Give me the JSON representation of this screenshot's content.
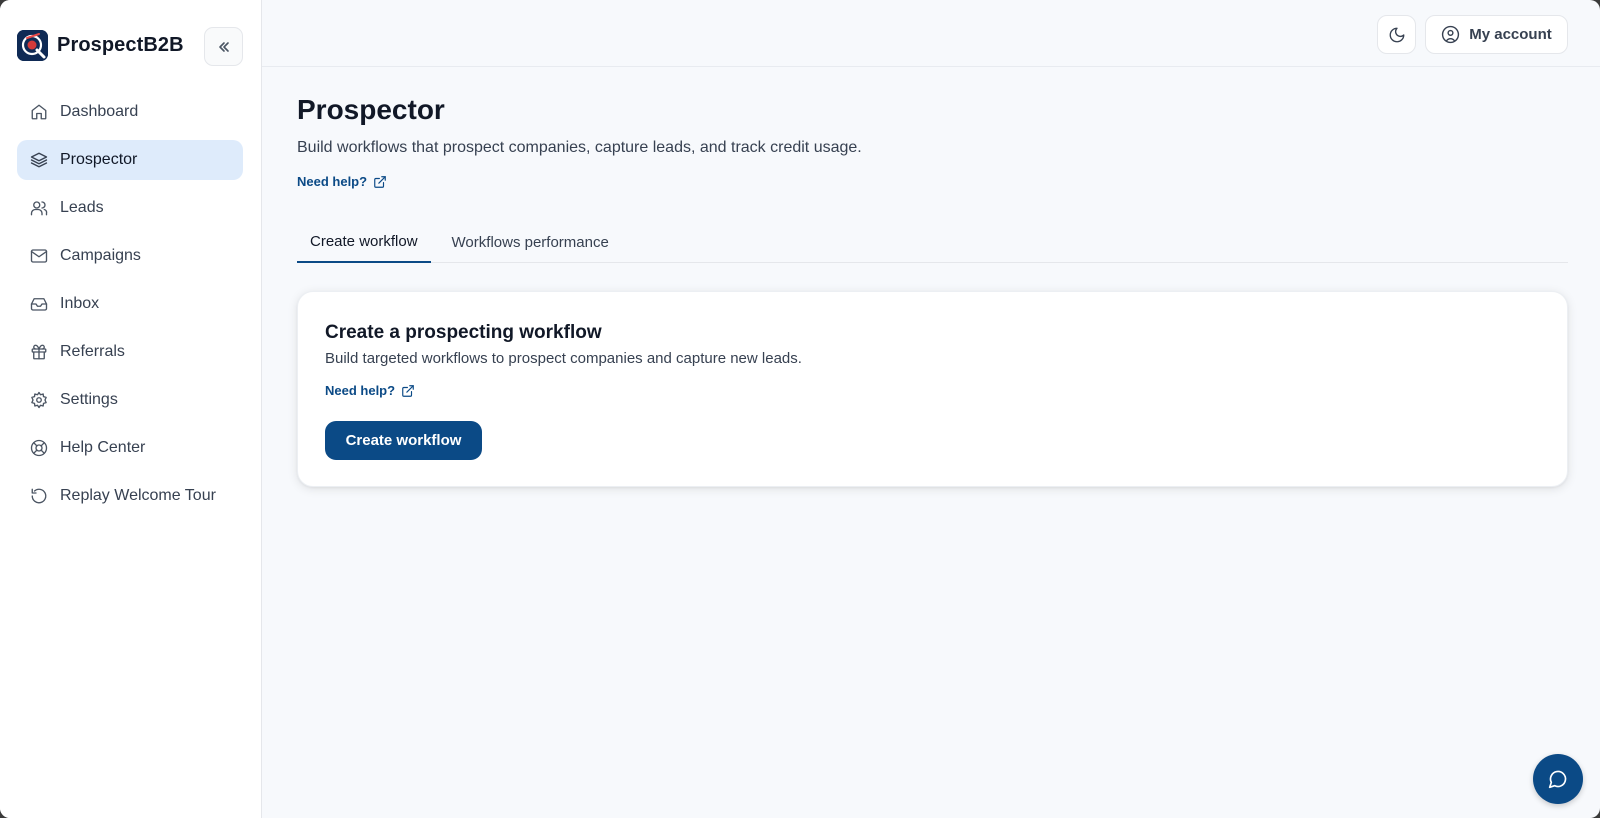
{
  "brand": {
    "name": "ProspectB2B"
  },
  "sidebar": {
    "items": [
      {
        "label": "Dashboard",
        "icon": "home-icon",
        "active": false
      },
      {
        "label": "Prospector",
        "icon": "layers-icon",
        "active": true
      },
      {
        "label": "Leads",
        "icon": "users-icon",
        "active": false
      },
      {
        "label": "Campaigns",
        "icon": "mail-icon",
        "active": false
      },
      {
        "label": "Inbox",
        "icon": "inbox-icon",
        "active": false
      },
      {
        "label": "Referrals",
        "icon": "gift-icon",
        "active": false
      },
      {
        "label": "Settings",
        "icon": "gear-icon",
        "active": false
      },
      {
        "label": "Help Center",
        "icon": "lifebuoy-icon",
        "active": false
      },
      {
        "label": "Replay Welcome Tour",
        "icon": "replay-icon",
        "active": false
      }
    ]
  },
  "topbar": {
    "account_label": "My account"
  },
  "page": {
    "title": "Prospector",
    "subtitle": "Build workflows that prospect companies, capture leads, and track credit usage.",
    "help_label": "Need help?"
  },
  "tabs": [
    {
      "label": "Create workflow",
      "active": true
    },
    {
      "label": "Workflows performance",
      "active": false
    }
  ],
  "card": {
    "title": "Create a prospecting workflow",
    "description": "Build targeted workflows to prospect companies and capture new leads.",
    "help_label": "Need help?",
    "button_label": "Create workflow"
  },
  "colors": {
    "accent": "#0b4a86",
    "active_nav_bg": "#deebfb"
  }
}
